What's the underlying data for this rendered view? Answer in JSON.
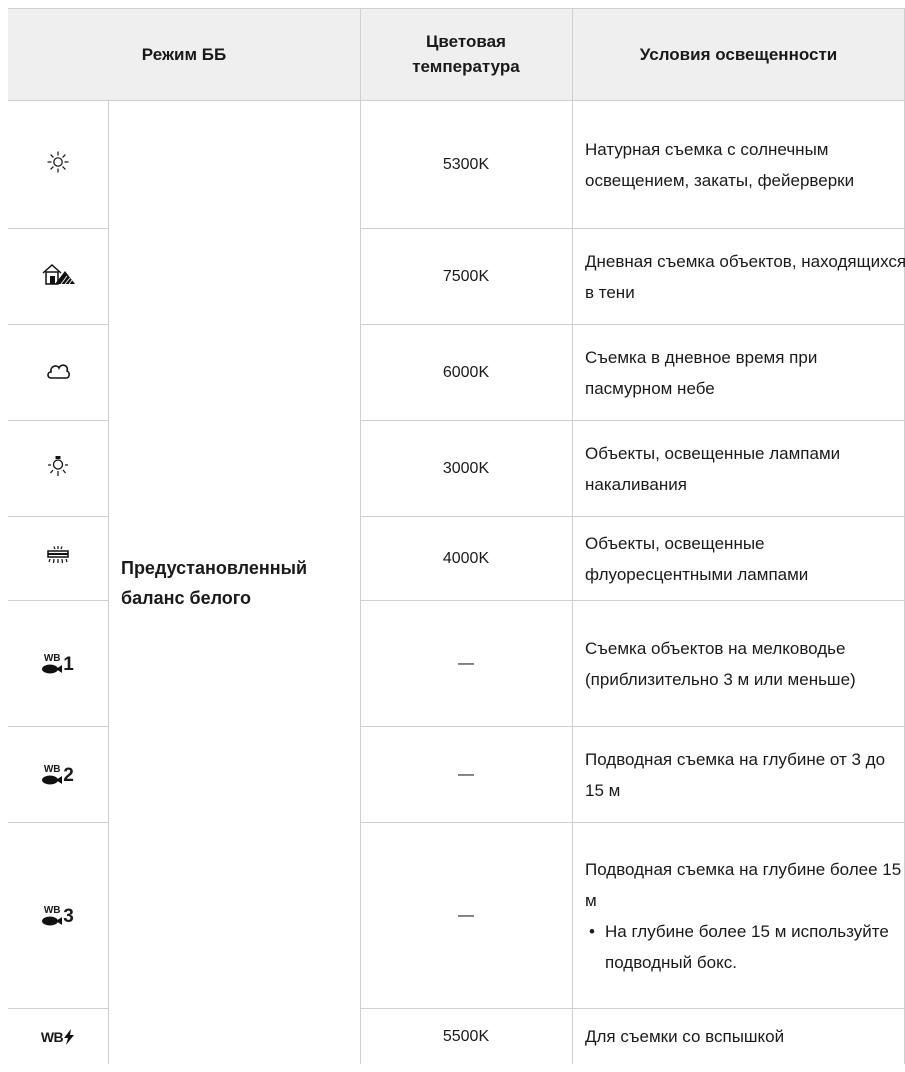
{
  "header": {
    "mode": "Режим ББ",
    "temp": "Цветовая температура",
    "conditions": "Условия освещенности"
  },
  "mode_label": "Предустановленный баланс белого",
  "rows": [
    {
      "icon": "sun-icon",
      "temp": "5300K",
      "conditions": [
        "Натурная съемка с солнечным освещением, закаты, фейерверки"
      ]
    },
    {
      "icon": "shade-icon",
      "temp": "7500K",
      "conditions": [
        "Дневная съемка объектов, находящихся в тени"
      ]
    },
    {
      "icon": "cloud-icon",
      "temp": "6000K",
      "conditions": [
        "Съемка в дневное время при пасмурном небе"
      ]
    },
    {
      "icon": "incandescent-bulb-icon",
      "temp": "3000K",
      "conditions": [
        "Объекты, освещенные лампами накаливания"
      ]
    },
    {
      "icon": "fluorescent-lamp-icon",
      "temp": "4000K",
      "conditions": [
        "Объекты, освещенные флуоресцентными лампами"
      ]
    },
    {
      "icon": "underwater-wb-1-icon",
      "icon_text": "WB",
      "icon_num": "1",
      "temp": "—",
      "conditions": [
        "Съемка объектов на мелководье (приблизительно 3 м или меньше)"
      ]
    },
    {
      "icon": "underwater-wb-2-icon",
      "icon_text": "WB",
      "icon_num": "2",
      "temp": "—",
      "conditions": [
        "Подводная съемка на глубине от 3 до 15 м"
      ]
    },
    {
      "icon": "underwater-wb-3-icon",
      "icon_text": "WB",
      "icon_num": "3",
      "temp": "—",
      "conditions": [
        "Подводная съемка на глубине более 15 м"
      ],
      "bullet": "На глубине более 15 м используйте подводный бокс."
    },
    {
      "icon": "flash-wb-icon",
      "icon_text": "WB",
      "temp": "5500K",
      "conditions": [
        "Для съемки со вспышкой"
      ]
    }
  ]
}
